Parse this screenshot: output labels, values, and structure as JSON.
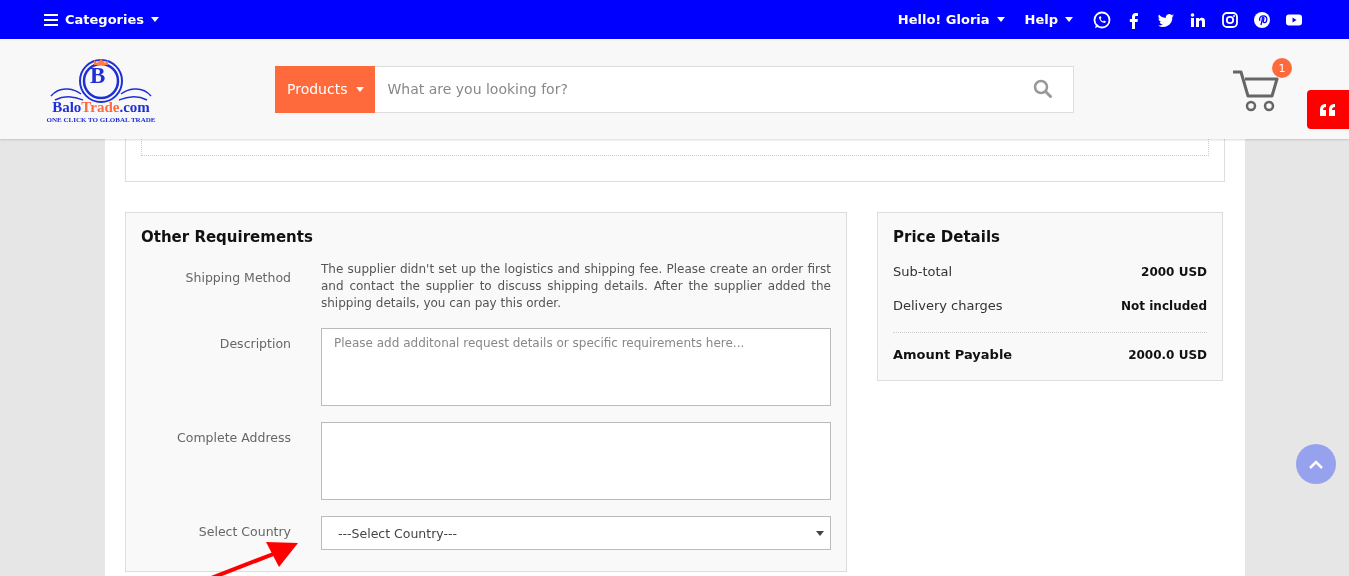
{
  "top_bar": {
    "categories": "Categories",
    "greeting": "Hello! Gloria",
    "help": "Help"
  },
  "header": {
    "logo": {
      "letter": "B",
      "name_parts": [
        "Balo",
        "Trade",
        ".com"
      ],
      "tagline": "ONE CLICK TO GLOBAL TRADE"
    },
    "search": {
      "category": "Products",
      "placeholder": "What are you looking for?"
    },
    "cart_count": "1"
  },
  "other_requirements": {
    "title": "Other Requirements",
    "rows": [
      {
        "kind": "text",
        "label": "Shipping Method",
        "value": "The supplier didn't set up the logistics and shipping fee. Please create an order first and contact the supplier to discuss shipping details. After the supplier added the shipping details, you can pay this order."
      },
      {
        "kind": "textarea",
        "label": "Description",
        "placeholder": "Please add additonal request details or specific requirements here..."
      },
      {
        "kind": "textarea",
        "label": "Complete Address"
      },
      {
        "kind": "select",
        "label": "Select Country",
        "value": "---Select Country---"
      }
    ]
  },
  "price_details": {
    "title": "Price Details",
    "rows": [
      {
        "label": "Sub-total",
        "value": "2000 USD",
        "total": false
      },
      {
        "label": "Delivery charges",
        "value": "Not included",
        "total": false
      },
      {
        "label": "Amount Payable",
        "value": "2000.0 USD",
        "total": true
      }
    ]
  }
}
